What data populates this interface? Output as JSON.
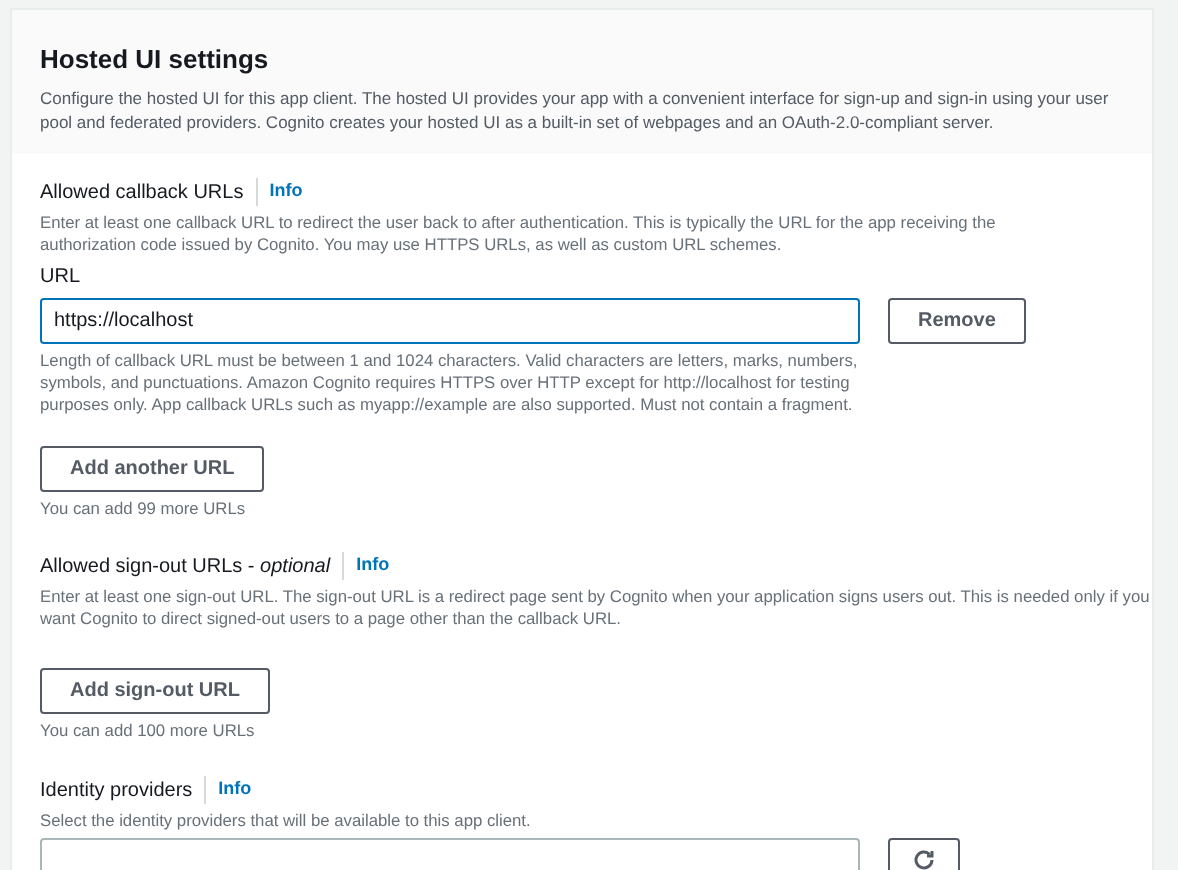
{
  "header": {
    "title": "Hosted UI settings",
    "description": "Configure the hosted UI for this app client. The hosted UI provides your app with a convenient interface for sign-up and sign-in using your user pool and federated providers. Cognito creates your hosted UI as a built-in set of webpages and an OAuth-2.0-compliant server."
  },
  "callback": {
    "label": "Allowed callback URLs",
    "info": "Info",
    "description": "Enter at least one callback URL to redirect the user back to after authentication. This is typically the URL for the app receiving the authorization code issued by Cognito. You may use HTTPS URLs, as well as custom URL schemes.",
    "field_label": "URL",
    "value": "https://localhost",
    "remove": "Remove",
    "constraint": "Length of callback URL must be between 1 and 1024 characters. Valid characters are letters, marks, numbers, symbols, and punctuations. Amazon Cognito requires HTTPS over HTTP except for http://localhost for testing purposes only. App callback URLs such as myapp://example are also supported. Must not contain a fragment.",
    "add": "Add another URL",
    "hint": "You can add 99 more URLs"
  },
  "signout": {
    "label": "Allowed sign-out URLs - *optional*",
    "info": "Info",
    "description": "Enter at least one sign-out URL. The sign-out URL is a redirect page sent by Cognito when your application signs users out. This is needed only if you want Cognito to direct signed-out users to a page other than the callback URL.",
    "add": "Add sign-out URL",
    "hint": "You can add 100 more URLs"
  },
  "identity": {
    "label": "Identity providers",
    "info": "Info",
    "description": "Select the identity providers that will be available to this app client."
  }
}
